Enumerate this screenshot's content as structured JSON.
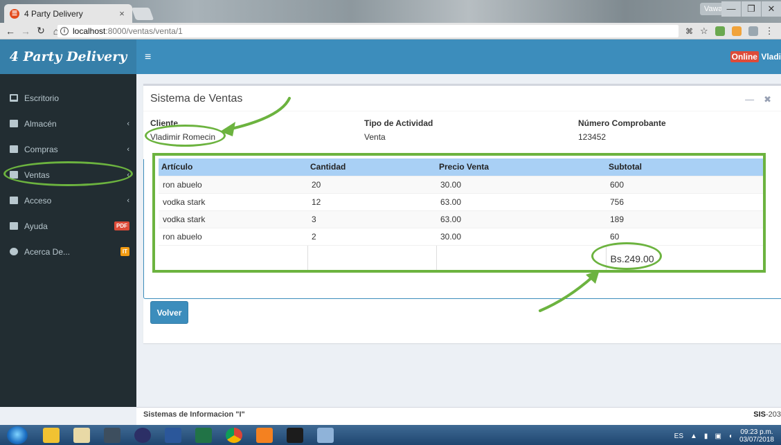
{
  "browser": {
    "tab_title": "4 Party Delivery",
    "tab_close": "×",
    "url_host": "localhost",
    "url_path": ":8000/ventas/venta/1",
    "user_button": "Vawar",
    "window_minimize": "—",
    "window_maximize": "❐",
    "window_close": "✕"
  },
  "app": {
    "logo": "4 Party Delivery",
    "menu_toggle": "≡",
    "online_badge": "Online",
    "username": "Vladi"
  },
  "sidebar": {
    "items": [
      {
        "label": "Escritorio",
        "icon": "desktop-icon"
      },
      {
        "label": "Almacén",
        "icon": "table-icon",
        "chevron": "‹"
      },
      {
        "label": "Compras",
        "icon": "money-icon",
        "chevron": "‹"
      },
      {
        "label": "Ventas",
        "icon": "cart-icon",
        "chevron": "‹"
      },
      {
        "label": "Acceso",
        "icon": "folder-icon",
        "chevron": "‹"
      },
      {
        "label": "Ayuda",
        "icon": "plus-square-icon",
        "badge": "PDF"
      },
      {
        "label": "Acerca De...",
        "icon": "info-circle-icon",
        "badge": "IT"
      }
    ]
  },
  "main": {
    "title": "Sistema de Ventas",
    "minimize": "—",
    "remove": "✖",
    "cliente_label": "Cliente",
    "cliente_value": "Vladimir Romecin",
    "tipo_label": "Tipo de Actividad",
    "tipo_value": "Venta",
    "comprobante_label": "Número Comprobante",
    "comprobante_value": "123452",
    "table": {
      "headers": [
        "Artículo",
        "Cantidad",
        "Precio Venta",
        "Subtotal"
      ],
      "rows": [
        [
          "ron abuelo",
          "20",
          "30.00",
          "600"
        ],
        [
          "vodka stark",
          "12",
          "63.00",
          "756"
        ],
        [
          "vodka stark",
          "3",
          "63.00",
          "189"
        ],
        [
          "ron abuelo",
          "2",
          "30.00",
          "60"
        ]
      ],
      "total": "Bs.249.00"
    },
    "back_button": "Volver"
  },
  "footer": {
    "left": "Sistemas de Informacion \"I\"",
    "right_bold": "SIS",
    "right": "-203"
  },
  "taskbar": {
    "language": "ES",
    "time": "09:23 p.m.",
    "date": "03/07/2018"
  },
  "colors": {
    "header": "#3c8dbc",
    "logo_bg": "#367fa9",
    "sidebar": "#222d32",
    "annotation": "#6cb33f",
    "table_header": "#a9d0f5"
  }
}
